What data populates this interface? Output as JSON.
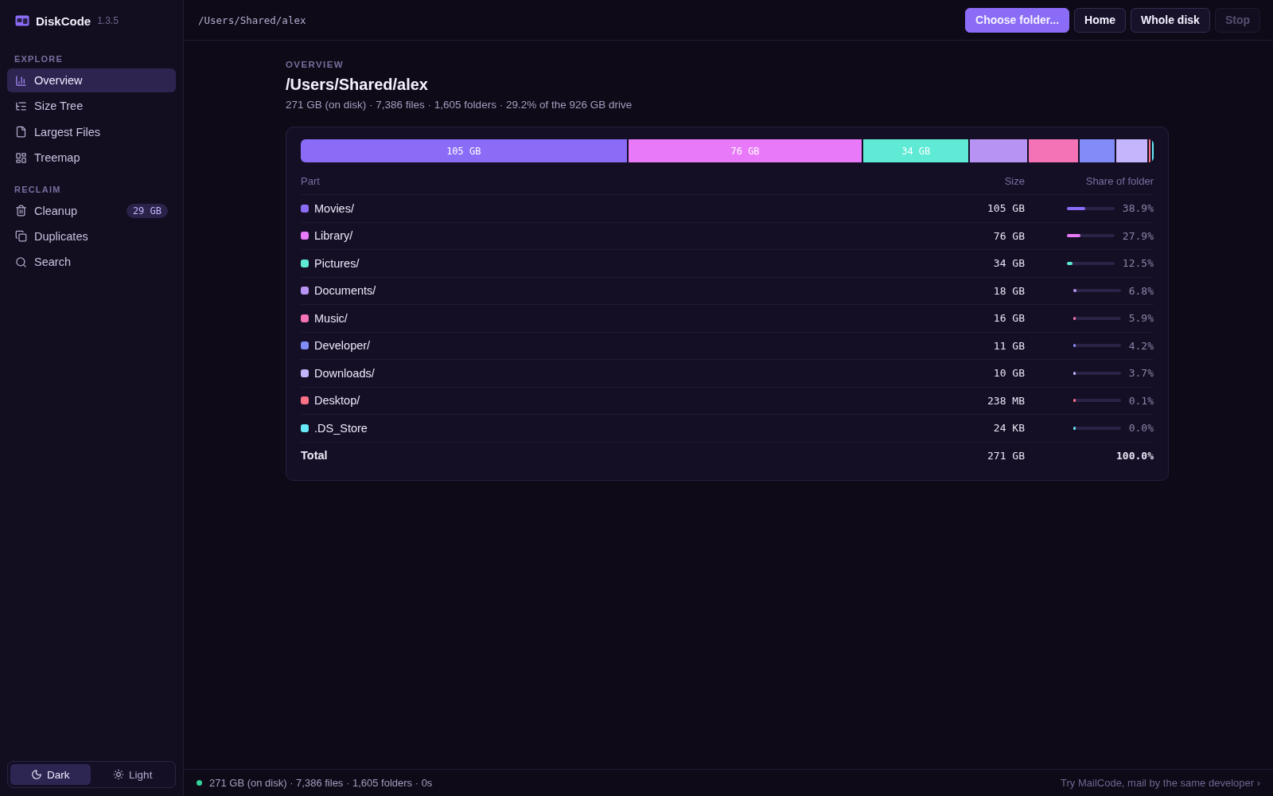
{
  "app": {
    "name": "DiskCode",
    "version": "1.3.5"
  },
  "sidebar": {
    "sections": [
      {
        "heading": "EXPLORE",
        "items": [
          {
            "label": "Overview",
            "selected": true
          },
          {
            "label": "Size Tree",
            "selected": false
          },
          {
            "label": "Largest Files",
            "selected": false
          },
          {
            "label": "Treemap",
            "selected": false
          }
        ]
      },
      {
        "heading": "RECLAIM",
        "items": [
          {
            "label": "Cleanup",
            "selected": false,
            "badge": "29 GB"
          },
          {
            "label": "Duplicates",
            "selected": false
          },
          {
            "label": "Search",
            "selected": false
          }
        ]
      }
    ],
    "theme_toggle": [
      {
        "label": "Dark",
        "selected": true
      },
      {
        "label": "Light",
        "selected": false
      }
    ]
  },
  "toolbar": {
    "path": "/Users/Shared/alex",
    "buttons": [
      {
        "label": "Choose folder...",
        "kind": "primary",
        "disabled": false
      },
      {
        "label": "Home",
        "kind": "secondary",
        "disabled": false
      },
      {
        "label": "Whole disk",
        "kind": "secondary",
        "disabled": false
      },
      {
        "label": "Stop",
        "kind": "secondary",
        "disabled": true
      }
    ]
  },
  "overview": {
    "eyebrow": "OVERVIEW",
    "title": "/Users/Shared/alex",
    "summary": "271 GB (on disk) · 7,386 files · 1,605 folders · 29.2% of the 926 GB drive",
    "columns": [
      "Part",
      "Size",
      "Share of folder"
    ],
    "rows": [
      {
        "name": "Movies/",
        "size": "105 GB",
        "share": "38.9%",
        "level": 0.389,
        "color": "#8b6cf7",
        "bar_label": "105 GB"
      },
      {
        "name": "Library/",
        "size": "76 GB",
        "share": "27.9%",
        "level": 0.279,
        "color": "#e879f9",
        "bar_label": "76 GB"
      },
      {
        "name": "Pictures/",
        "size": "34 GB",
        "share": "12.5%",
        "level": 0.125,
        "color": "#5eead4",
        "bar_label": "34 GB"
      },
      {
        "name": "Documents/",
        "size": "18 GB",
        "share": "6.8%",
        "level": 0.068,
        "color": "#b794f4"
      },
      {
        "name": "Music/",
        "size": "16 GB",
        "share": "5.9%",
        "level": 0.059,
        "color": "#f472b6"
      },
      {
        "name": "Developer/",
        "size": "11 GB",
        "share": "4.2%",
        "level": 0.042,
        "color": "#818cf8"
      },
      {
        "name": "Downloads/",
        "size": "10 GB",
        "share": "3.7%",
        "level": 0.037,
        "color": "#c4b5fd"
      },
      {
        "name": "Desktop/",
        "size": "238 MB",
        "share": "0.1%",
        "level": 0.001,
        "color": "#fb7185"
      },
      {
        "name": ".DS_Store",
        "size": "24 KB",
        "share": "0.0%",
        "level": 0.0,
        "color": "#67e8f9"
      }
    ],
    "total": {
      "label": "Total",
      "size": "271 GB",
      "share": "100.0%"
    }
  },
  "status_bar": {
    "text": "271 GB (on disk) · 7,386 files · 1,605 folders · 0s",
    "link": "Try MailCode, mail by the same developer ›"
  }
}
